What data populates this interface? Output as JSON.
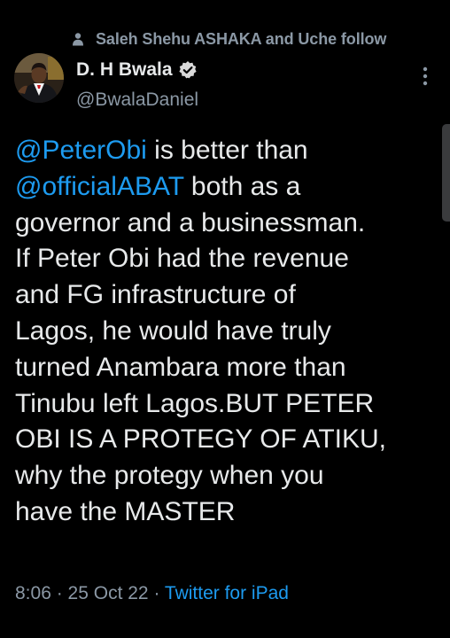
{
  "social_context": {
    "text": "Saleh Shehu ASHAKA and Uche follow",
    "icon": "person-icon"
  },
  "author": {
    "display_name": "D. H Bwala",
    "handle": "@BwalaDaniel",
    "verified": true,
    "verified_icon": "verified-badge-icon",
    "avatar_icon": "avatar"
  },
  "tweet": {
    "lines": [
      [
        {
          "text": "@PeterObi",
          "mention": true
        },
        {
          "text": " is better than",
          "mention": false
        }
      ],
      [
        {
          "text": "@officialABAT",
          "mention": true
        },
        {
          "text": " both as a",
          "mention": false
        }
      ],
      [
        {
          "text": "governor and a businessman.",
          "mention": false
        }
      ],
      [
        {
          "text": "If Peter Obi had the revenue",
          "mention": false
        }
      ],
      [
        {
          "text": "and FG infrastructure of",
          "mention": false
        }
      ],
      [
        {
          "text": "Lagos, he would have truly",
          "mention": false
        }
      ],
      [
        {
          "text": "turned Anambara more than",
          "mention": false
        }
      ],
      [
        {
          "text": "Tinubu left Lagos.BUT PETER",
          "mention": false
        }
      ],
      [
        {
          "text": "OBI IS A PROTEGY OF ATIKU,",
          "mention": false
        }
      ],
      [
        {
          "text": "why the protegy when you",
          "mention": false
        }
      ],
      [
        {
          "text": "have the MASTER",
          "mention": false
        }
      ]
    ]
  },
  "meta": {
    "time": "8:06",
    "separator": " · ",
    "date": "25 Oct 22",
    "source": "Twitter for iPad"
  },
  "menu": {
    "icon": "more-vertical-icon"
  },
  "colors": {
    "background": "#000000",
    "text": "#e7e9ea",
    "secondary": "#8b98a5",
    "link": "#1d9bf0",
    "verified": "#d9d9d9"
  }
}
